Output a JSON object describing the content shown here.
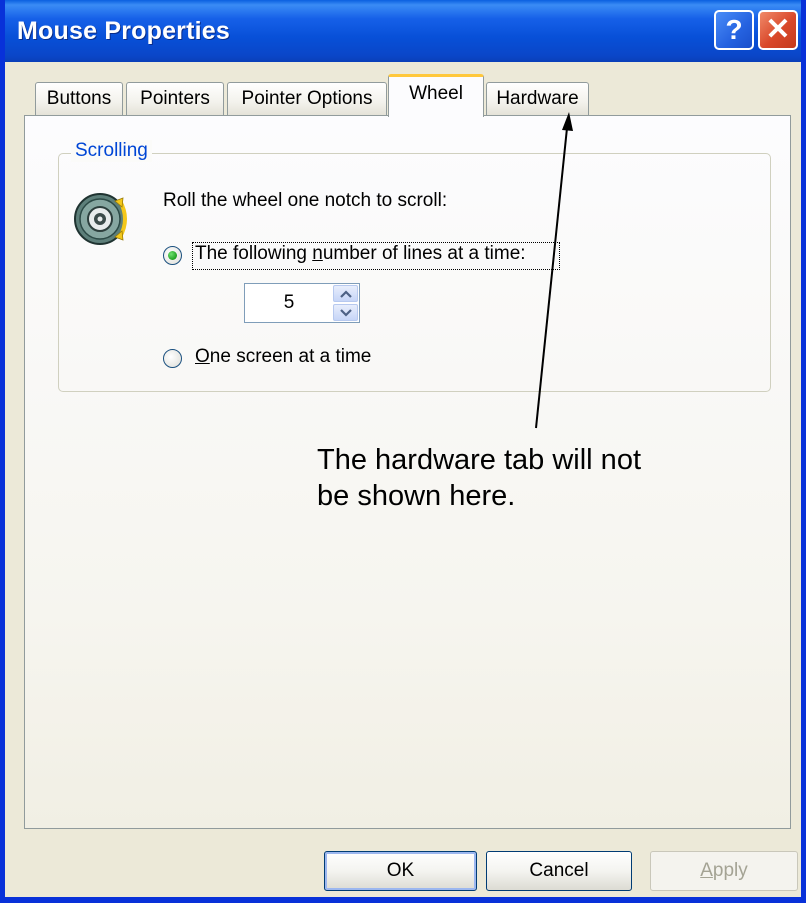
{
  "window": {
    "title": "Mouse Properties",
    "help_glyph": "?",
    "close_glyph": "✕"
  },
  "tabs": [
    {
      "label": "Buttons",
      "active": false
    },
    {
      "label": "Pointers",
      "active": false
    },
    {
      "label": "Pointer Options",
      "active": false
    },
    {
      "label": "Wheel",
      "active": true
    },
    {
      "label": "Hardware",
      "active": false
    }
  ],
  "scrolling": {
    "group_label": "Scrolling",
    "instruction": "Roll the wheel one notch to scroll:",
    "option_lines_pre": "The following ",
    "option_lines_accel": "n",
    "option_lines_post": "umber of lines at a time:",
    "option_lines_selected": true,
    "lines_value": "5",
    "option_screen_accel": "O",
    "option_screen_post": "ne screen at a time",
    "option_screen_selected": false
  },
  "buttons": {
    "ok": "OK",
    "cancel": "Cancel",
    "apply_accel": "A",
    "apply_rest": "pply",
    "apply_enabled": false
  },
  "annotation": {
    "line1": "The hardware tab will not",
    "line2": "be shown here."
  },
  "icons": [
    "help-icon",
    "close-icon",
    "mouse-wheel-icon",
    "spin-up-icon",
    "spin-down-icon",
    "annotation-arrow"
  ],
  "colors": {
    "titlebar": "#0a50d8",
    "active_tab_highlight": "#ffc83c",
    "group_label": "#0046d5",
    "close_button": "#d9482a"
  }
}
